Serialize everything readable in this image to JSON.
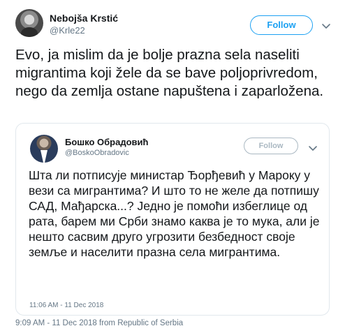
{
  "author": {
    "name": "Nebojša Krstić",
    "handle": "@Krle22",
    "follow_label": "Follow"
  },
  "tweet": {
    "text": "Evo, ja mislim da je bolje prazna sela naseliti migrantima koji žele da se bave poljoprivredom, nego da zemlja ostane napuštena i zaparložena.",
    "time": "9:09 AM - 11 Dec 2018",
    "from_label": "from",
    "location": "Republic of Serbia"
  },
  "quoted": {
    "name": "Бошко Обрадовић",
    "handle": "@BoskoObradovic",
    "follow_label": "Follow",
    "text": "Шта ли потписује министар Ђорђевић у Мароку у вези са мигрантима? И што то не желе да потпишу САД, Мађарска...? Једно је помоћи избеглице од рата, барем ми Срби знамо каква је то мука, али је нешто сасвим друго угрозити безбедност своје земље и населити празна села мигрантима.",
    "time": "11:06 AM - 11 Dec 2018"
  },
  "icons": {
    "more": "chevron-down-icon"
  },
  "colors": {
    "accent": "#1da1f2",
    "secondary_text": "#657786",
    "border": "#e1e8ed"
  }
}
